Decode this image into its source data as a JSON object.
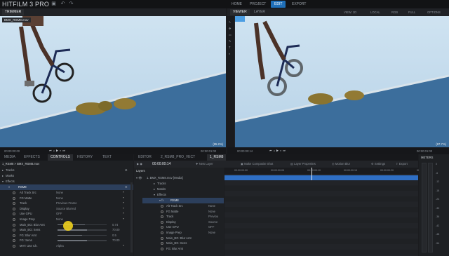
{
  "app": {
    "title": "HITFILM 3 PRO"
  },
  "nav": {
    "tabs": [
      "HOME",
      "PROJECT",
      "EDIT",
      "EXPORT"
    ],
    "active": "EDIT"
  },
  "trimmer": {
    "tab": "TRIMMER",
    "clip_label": "BMX_RSM8.mov",
    "zoom": "(65.2%)",
    "time_left": "00:00:00:00",
    "time_right": "00:00:01:00"
  },
  "viewer": {
    "tabs": [
      "VIEWER",
      "LAYER"
    ],
    "view": "VIEW: 2D",
    "space": "LOCAL",
    "channel": "RGB",
    "quality": "FULL",
    "options": "OPTIONS",
    "zoom": "(67.7%)",
    "time_left": "00:00:00:14",
    "time_right": "00:00:01:00"
  },
  "left_panel": {
    "tabs": [
      "MEDIA",
      "EFFECTS",
      "CONTROLS",
      "HISTORY",
      "TEXT"
    ],
    "active_tab": "CONTROLS",
    "path": "1_RSM8 > BMX_RSM8.mov",
    "tree": [
      "Tracks",
      "Masks",
      "Effects"
    ],
    "effect_name": "RSM8",
    "rows": [
      {
        "label": "Alt Track Src",
        "value": "None"
      },
      {
        "label": "FG Matte",
        "value": "None"
      },
      {
        "label": "Track",
        "value": "Previous Frame"
      },
      {
        "label": "Display",
        "value": "Source Blurred"
      },
      {
        "label": "Use GPU",
        "value": "OFF"
      },
      {
        "label": "Image Prep",
        "value": "None"
      },
      {
        "label": "Main_BG: Blur Amt",
        "value": "0.74"
      },
      {
        "label": "Main_BG: Sens",
        "value": "70.00"
      },
      {
        "label": "FG: Blur Amt",
        "value": "0.5"
      },
      {
        "label": "FG: Sens",
        "value": "70.00"
      },
      {
        "label": "MAT: Use Ch.",
        "value": "Alpha"
      }
    ]
  },
  "editor": {
    "tabs": [
      "EDITOR",
      "2_RSM8_PRO_VECT",
      "1_RSM8"
    ],
    "active_tab": "1_RSM8",
    "timecode": "00:00:00:14",
    "new_layer": "New Layer",
    "make_composite": "Make Composite Shot",
    "layer_properties": "Layer Properties",
    "motion_blur": "Motion Blur",
    "settings": "Settings",
    "export": "Export",
    "layers_header": "Layers",
    "layer_name": "1. BMX_RSM8.mov [Media]",
    "tree": [
      "Tracks",
      "Masks",
      "Effects"
    ],
    "effect_name": "RSM8",
    "rows": [
      {
        "label": "Alt Track Src",
        "value": "None"
      },
      {
        "label": "FG Matte",
        "value": "None"
      },
      {
        "label": "Track",
        "value": "Previou"
      },
      {
        "label": "Display",
        "value": "Source"
      },
      {
        "label": "Use GPU",
        "value": "OFF"
      },
      {
        "label": "Image Prep",
        "value": "None"
      },
      {
        "label": "Main_BG: Blur Amt",
        "value": ""
      },
      {
        "label": "Main_BG: Sens",
        "value": ""
      },
      {
        "label": "FG: Blur Amt",
        "value": ""
      }
    ],
    "ruler": [
      "00:00:00:00",
      "00:00:00:05",
      "00:00:00:10",
      "00:00:00:15",
      "00:00:00:20",
      "00:00:01:00"
    ]
  },
  "meters": {
    "title": "METERS",
    "scale": [
      "0",
      "-6",
      "-12",
      "-18",
      "-24",
      "-30",
      "-36",
      "-42",
      "-48",
      "-54"
    ]
  },
  "colors": {
    "accent": "#1f6fb8",
    "track_bar": "#2f6fc4",
    "cursor": "#f0d21e"
  }
}
